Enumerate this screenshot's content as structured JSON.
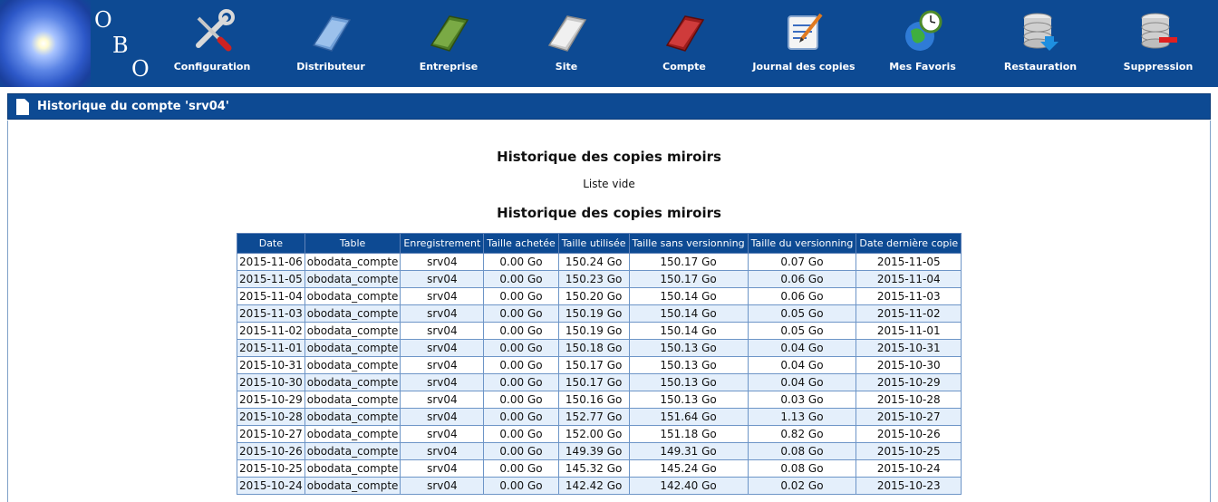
{
  "logo": {
    "letters": [
      "O",
      "B",
      "O"
    ]
  },
  "nav": [
    {
      "label": "Configuration",
      "icon": "wrench-screwdriver-icon"
    },
    {
      "label": "Distributeur",
      "icon": "blue-folder-icon"
    },
    {
      "label": "Entreprise",
      "icon": "green-folder-icon"
    },
    {
      "label": "Site",
      "icon": "white-folder-icon"
    },
    {
      "label": "Compte",
      "icon": "red-folder-icon"
    },
    {
      "label": "Journal des copies",
      "icon": "notepad-pen-icon"
    },
    {
      "label": "Mes Favoris",
      "icon": "globe-clock-icon"
    },
    {
      "label": "Restauration",
      "icon": "database-download-icon"
    },
    {
      "label": "Suppression",
      "icon": "database-remove-icon"
    }
  ],
  "colors": {
    "nav_bg": "#0d4a93",
    "row_alt": "#e4effb",
    "border": "#6d95c7"
  },
  "page": {
    "title": "Historique du compte 'srv04'"
  },
  "section1": {
    "title": "Historique des copies miroirs",
    "empty": "Liste vide"
  },
  "section2": {
    "title": "Historique des copies miroirs"
  },
  "table": {
    "headers": [
      "Date",
      "Table",
      "Enregistrement",
      "Taille achetée",
      "Taille utilisée",
      "Taille sans versionning",
      "Taille du versionning",
      "Date dernière copie"
    ],
    "rows": [
      [
        "2015-11-06",
        "obodata_compte",
        "srv04",
        "0.00 Go",
        "150.24 Go",
        "150.17 Go",
        "0.07 Go",
        "2015-11-05"
      ],
      [
        "2015-11-05",
        "obodata_compte",
        "srv04",
        "0.00 Go",
        "150.23 Go",
        "150.17 Go",
        "0.06 Go",
        "2015-11-04"
      ],
      [
        "2015-11-04",
        "obodata_compte",
        "srv04",
        "0.00 Go",
        "150.20 Go",
        "150.14 Go",
        "0.06 Go",
        "2015-11-03"
      ],
      [
        "2015-11-03",
        "obodata_compte",
        "srv04",
        "0.00 Go",
        "150.19 Go",
        "150.14 Go",
        "0.05 Go",
        "2015-11-02"
      ],
      [
        "2015-11-02",
        "obodata_compte",
        "srv04",
        "0.00 Go",
        "150.19 Go",
        "150.14 Go",
        "0.05 Go",
        "2015-11-01"
      ],
      [
        "2015-11-01",
        "obodata_compte",
        "srv04",
        "0.00 Go",
        "150.18 Go",
        "150.13 Go",
        "0.04 Go",
        "2015-10-31"
      ],
      [
        "2015-10-31",
        "obodata_compte",
        "srv04",
        "0.00 Go",
        "150.17 Go",
        "150.13 Go",
        "0.04 Go",
        "2015-10-30"
      ],
      [
        "2015-10-30",
        "obodata_compte",
        "srv04",
        "0.00 Go",
        "150.17 Go",
        "150.13 Go",
        "0.04 Go",
        "2015-10-29"
      ],
      [
        "2015-10-29",
        "obodata_compte",
        "srv04",
        "0.00 Go",
        "150.16 Go",
        "150.13 Go",
        "0.03 Go",
        "2015-10-28"
      ],
      [
        "2015-10-28",
        "obodata_compte",
        "srv04",
        "0.00 Go",
        "152.77 Go",
        "151.64 Go",
        "1.13 Go",
        "2015-10-27"
      ],
      [
        "2015-10-27",
        "obodata_compte",
        "srv04",
        "0.00 Go",
        "152.00 Go",
        "151.18 Go",
        "0.82 Go",
        "2015-10-26"
      ],
      [
        "2015-10-26",
        "obodata_compte",
        "srv04",
        "0.00 Go",
        "149.39 Go",
        "149.31 Go",
        "0.08 Go",
        "2015-10-25"
      ],
      [
        "2015-10-25",
        "obodata_compte",
        "srv04",
        "0.00 Go",
        "145.32 Go",
        "145.24 Go",
        "0.08 Go",
        "2015-10-24"
      ],
      [
        "2015-10-24",
        "obodata_compte",
        "srv04",
        "0.00 Go",
        "142.42 Go",
        "142.40 Go",
        "0.02 Go",
        "2015-10-23"
      ]
    ]
  }
}
